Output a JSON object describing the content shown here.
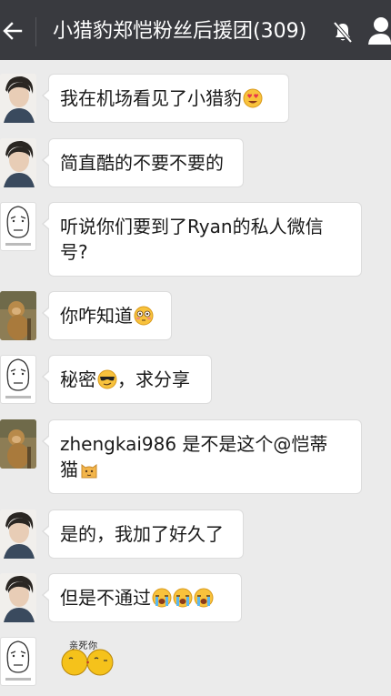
{
  "header": {
    "back_icon": "arrow-left-icon",
    "title": "小猎豹郑恺粉丝后援团(309)",
    "mute_icon": "bell-muted-icon",
    "profile_icon": "person-icon",
    "background": "#393a3f"
  },
  "messages": [
    {
      "avatar": "boy-photo",
      "text": "我在机场看见了小猎豹",
      "emojis": [
        "heart-eyes-emoji"
      ]
    },
    {
      "avatar": "boy-photo",
      "text": "简直酷的不要不要的",
      "emojis": []
    },
    {
      "avatar": "meme-face",
      "text_line1": "听说你们要到了Ryan的私人微信",
      "text_line2": "号?",
      "emojis": []
    },
    {
      "avatar": "monkey-photo",
      "text": "你咋知道",
      "emojis": [
        "flushed-emoji"
      ]
    },
    {
      "avatar": "meme-face",
      "text_a": "秘密",
      "text_b": "，求分享",
      "emojis": [
        "sunglasses-emoji"
      ]
    },
    {
      "avatar": "monkey-photo",
      "text_line1": "zhengkai986 是不是这个@恺蒂",
      "text_line2": "猫",
      "emojis": [
        "cat-emoji"
      ]
    },
    {
      "avatar": "boy-photo",
      "text": "是的，我加了好久了",
      "emojis": []
    },
    {
      "avatar": "boy-photo",
      "text": "但是不通过",
      "emojis": [
        "crying-emoji",
        "crying-emoji",
        "crying-emoji"
      ]
    },
    {
      "avatar": "meme-face",
      "sticker_text": "亲死你",
      "sticker": "kiss-sticker"
    }
  ],
  "colors": {
    "chat_background": "#ebebeb",
    "bubble": "#ffffff",
    "bubble_border": "#dcdcdc"
  }
}
